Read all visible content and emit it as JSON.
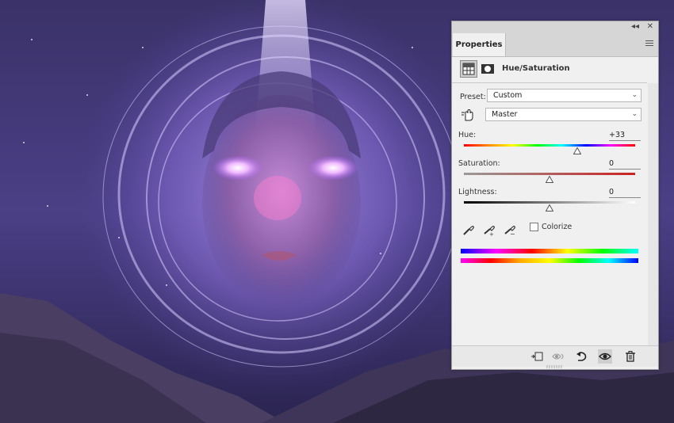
{
  "panel": {
    "tab_label": "Properties",
    "adjustment_title": "Hue/Saturation",
    "preset_label": "Preset:",
    "preset_value": "Custom",
    "channel_value": "Master",
    "hue": {
      "label": "Hue:",
      "value": "+33",
      "slider_fraction": 0.66
    },
    "saturation": {
      "label": "Saturation:",
      "value": "0",
      "slider_fraction": 0.5
    },
    "lightness": {
      "label": "Lightness:",
      "value": "0",
      "slider_fraction": 0.5
    },
    "colorize_label": "Colorize"
  },
  "icons": {
    "collapse": "double-chevron-left-icon",
    "close": "close-icon",
    "menu": "hamburger-menu-icon",
    "eyedroppers": [
      "eyedropper-icon",
      "eyedropper-plus-icon",
      "eyedropper-minus-icon"
    ],
    "footer": [
      "clip-to-layer-icon",
      "view-previous-state-icon",
      "reset-icon",
      "visibility-eye-icon",
      "trash-icon"
    ]
  },
  "colors": {
    "panel_bg": "#f0f0f0",
    "saturation_end": "#cc2222"
  }
}
